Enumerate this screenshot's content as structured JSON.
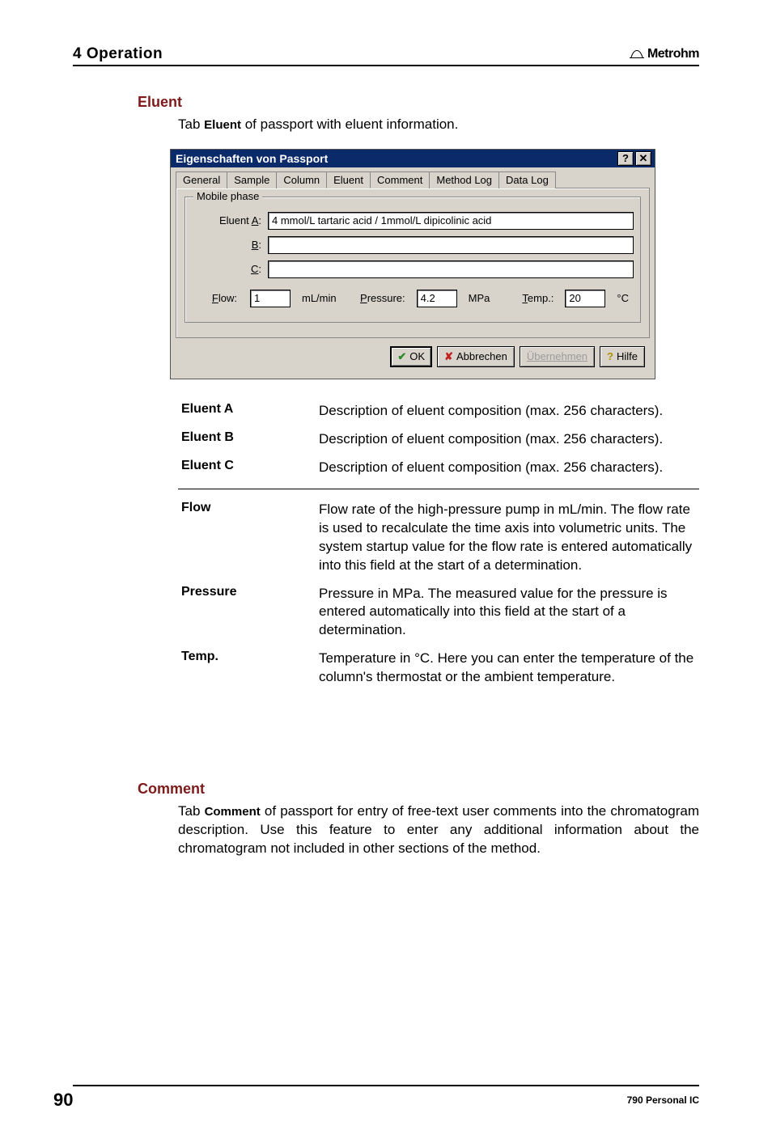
{
  "header": {
    "chapter": "4 Operation",
    "brand": "Metrohm"
  },
  "section_eluent": {
    "title": "Eluent",
    "intro_pre": "Tab ",
    "intro_bold": "Eluent",
    "intro_post": " of passport with eluent information."
  },
  "dialog": {
    "title": "Eigenschaften von Passport",
    "tabs": [
      "General",
      "Sample",
      "Column",
      "Eluent",
      "Comment",
      "Method Log",
      "Data Log"
    ],
    "active_tab_index": 3,
    "fieldset_title": "Mobile phase",
    "labels": {
      "eluentA": "Eluent A:",
      "eluentB": "B:",
      "eluentC": "C:",
      "flow": "Flow:",
      "flow_unit": "mL/min",
      "pressure": "Pressure:",
      "pressure_unit": "MPa",
      "temp": "Temp.:",
      "temp_unit": "°C"
    },
    "values": {
      "eluentA": "4 mmol/L tartaric acid / 1mmol/L dipicolinic acid",
      "eluentB": "",
      "eluentC": "",
      "flow": "1",
      "pressure": "4.2",
      "temp": "20"
    },
    "buttons": {
      "ok": "OK",
      "cancel": "Abbrechen",
      "apply": "Übernehmen",
      "help": "Hilfe"
    }
  },
  "definitions": [
    {
      "term": "Eluent A",
      "desc": "Description of eluent composition (max. 256 characters)."
    },
    {
      "term": "Eluent B",
      "desc": "Description of eluent composition (max. 256 characters)."
    },
    {
      "term": "Eluent C",
      "desc": "Description of eluent composition (max. 256 characters)."
    },
    {
      "term": "Flow",
      "desc": "Flow rate of the high-pressure pump in mL/min. The flow rate is used to recalculate the time axis into volumetric units. The system startup value for the flow rate is entered automatically into this field at the start of a determination."
    },
    {
      "term": "Pressure",
      "desc": "Pressure in MPa. The measured value for the pressure is entered automatically into this field at the start of a determination."
    },
    {
      "term": "Temp.",
      "desc": "Temperature in °C. Here you can enter the temperature of the column's thermostat or the ambient temperature."
    }
  ],
  "section_comment": {
    "title": "Comment",
    "text_pre": "Tab ",
    "text_bold": "Comment",
    "text_post": " of passport for entry of free-text user comments into the chromatogram description. Use this feature to enter any additional information about the chromatogram not included in other sections of the method."
  },
  "footer": {
    "page": "90",
    "product": "790 Personal IC"
  }
}
